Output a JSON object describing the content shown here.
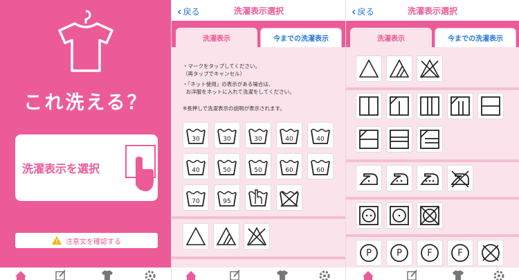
{
  "panel1": {
    "title": "これ洗える？",
    "select_button": "洗濯表示を選択",
    "notice_button": "注意文を確認する"
  },
  "nav": {
    "back": "戻る",
    "title": "洗濯表示選択",
    "tab_active": "洗濯表示",
    "tab_inactive": "今までの洗濯表示"
  },
  "instructions": {
    "line1": "・マークをタップしてください。",
    "line1b": "（再タップでキャンセル）",
    "line2": "・「ネット使用」の表示がある場合は、",
    "line2b": "お洋服をネットに入れて洗濯をしてください。",
    "hint": "※長押しで洗濯表示の説明が表示されます。"
  },
  "wash_temps": [
    "30",
    "30",
    "30",
    "40",
    "40",
    "40",
    "50",
    "50",
    "60",
    "60",
    "70",
    "95"
  ],
  "dry_labels": [
    "P",
    "P",
    "F",
    "F"
  ],
  "colors": {
    "accent": "#ec5b97",
    "link": "#2a7ad8",
    "bg_soft": "#fbe3ec"
  }
}
